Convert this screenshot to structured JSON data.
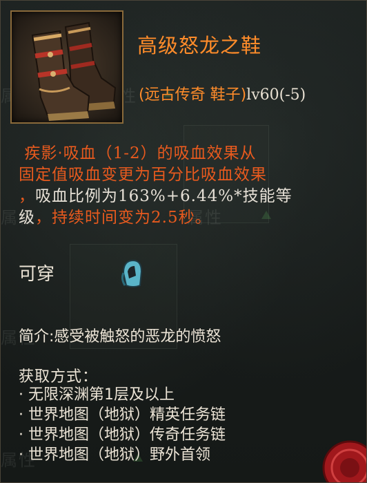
{
  "item": {
    "name": "高级怒龙之鞋",
    "type_prefix": "(远古传奇 鞋子)",
    "level": "lv60(-5)",
    "icon": "boots-icon"
  },
  "effect": {
    "p1": "疾影·吸血（",
    "p2": "1-2",
    "p3": "）的吸血效果从",
    "p4": "固定值吸血变更为百分比吸血效果",
    "p5": "，",
    "p6": "吸血比例为",
    "p7": "163%+6.44%*",
    "p8": "技能等",
    "p9": "级",
    "p10": "，持续时间变为",
    "p11": "2.5",
    "p12": "秒。"
  },
  "wearable": {
    "label": "可穿",
    "icon": "helmet-icon"
  },
  "intro": {
    "text": "简介:感受被触怒的恶龙的愤怒"
  },
  "obtain": {
    "title": "获取方式：",
    "items": [
      "无限深渊第1层及以上",
      "世界地图（地狱）精英任务链",
      "世界地图（地狱）传奇任务链",
      "世界地图（地狱）野外首领"
    ]
  },
  "colors": {
    "title_orange": "#ff8c2a",
    "effect_red": "#e85a1e",
    "text_light": "#ece4d6"
  }
}
